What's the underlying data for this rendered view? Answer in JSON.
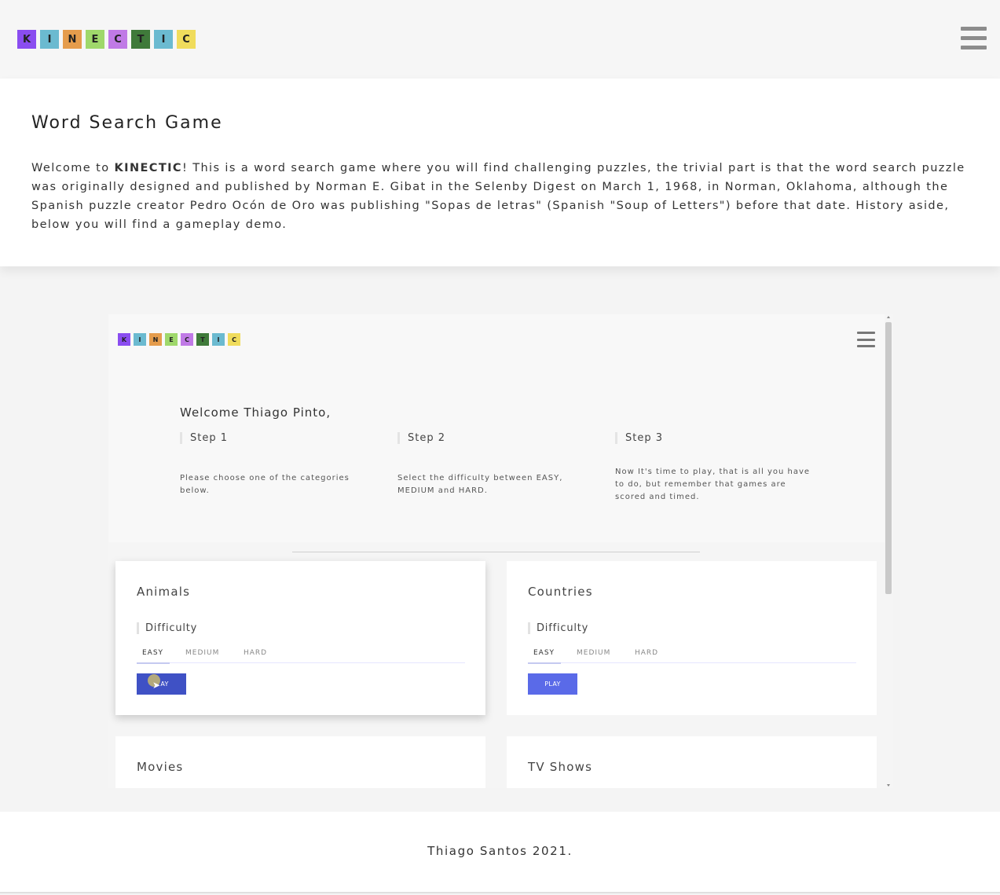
{
  "header": {
    "logo_letters": [
      "K",
      "I",
      "N",
      "E",
      "C",
      "T",
      "I",
      "C"
    ],
    "logo_colors": [
      "#8a4df0",
      "#6bbad0",
      "#e59c4c",
      "#9fd86b",
      "#c07ae6",
      "#3f7a3a",
      "#6bbad0",
      "#f0dc5c"
    ],
    "menu_icon": "hamburger-menu-icon"
  },
  "intro": {
    "title": "Word Search Game",
    "text_before": "Welcome to ",
    "brand": "KINECTIC",
    "text_after": "! This is a word search game where you will find challenging puzzles, the trivial part is that the word search puzzle was originally designed and published by Norman E. Gibat in the Selenby Digest on March 1, 1968, in Norman, Oklahoma, although the Spanish puzzle creator Pedro Ocón de Oro was publishing \"Sopas de letras\" (Spanish \"Soup of Letters\") before that date. History aside, below you will find a gameplay demo."
  },
  "demo": {
    "welcome": "Welcome Thiago Pinto,",
    "steps": [
      {
        "title": "Step 1",
        "description": "Please choose one of the categories below."
      },
      {
        "title": "Step 2",
        "description": "Select the difficulty between EASY, MEDIUM and HARD."
      },
      {
        "title": "Step 3",
        "description": "Now It's time to play, that is all you have to do, but remember that games are scored and timed."
      }
    ],
    "difficulty_label": "Difficulty",
    "tabs": [
      "EASY",
      "MEDIUM",
      "HARD"
    ],
    "play_label": "PLAY",
    "play_label_partial": "AY",
    "play_colors": [
      "#3f51c5",
      "#5a6ae8"
    ],
    "categories": [
      {
        "title": "Animals"
      },
      {
        "title": "Countries"
      },
      {
        "title": "Movies"
      },
      {
        "title": "TV Shows"
      }
    ]
  },
  "footer": {
    "text": "Thiago Santos 2021."
  }
}
